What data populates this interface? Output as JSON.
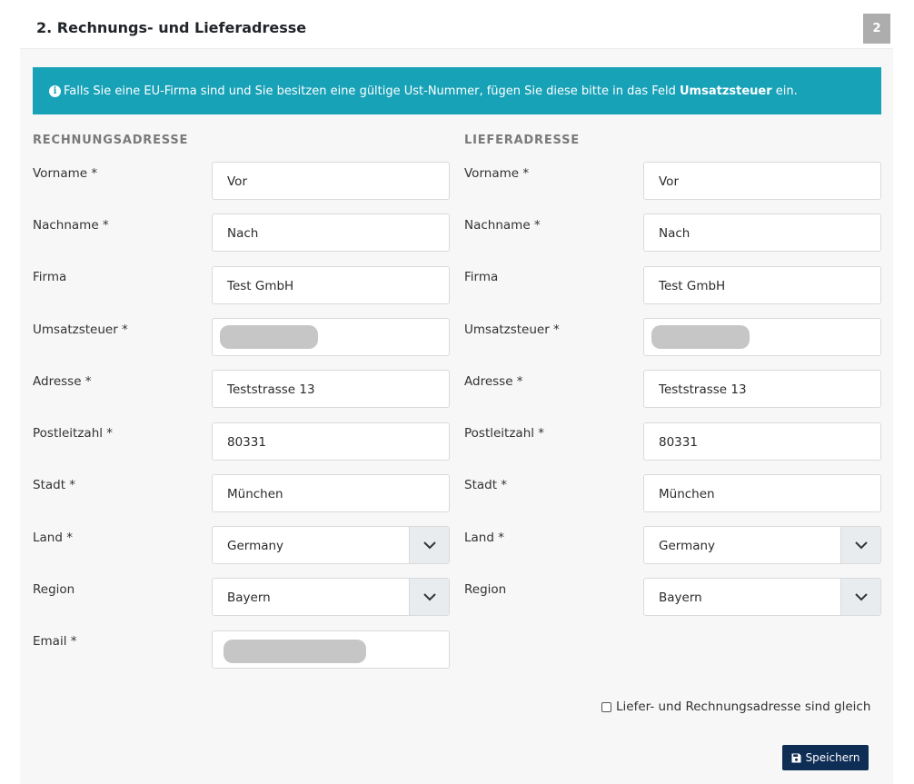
{
  "panel": {
    "title": "2. Rechnungs- und Lieferadresse",
    "step_number": "2"
  },
  "alert": {
    "text_before": "Falls Sie eine EU-Firma sind und Sie besitzen eine gültige Ust-Nummer, fügen Sie diese bitte in das Feld ",
    "text_bold": "Umsatzsteuer",
    "text_after": " ein."
  },
  "billing": {
    "heading": "RECHNUNGSADRESSE",
    "fields": {
      "vorname": {
        "label": "Vorname *",
        "value": "Vor"
      },
      "nachname": {
        "label": "Nachname *",
        "value": "Nach"
      },
      "firma": {
        "label": "Firma",
        "value": "Test GmbH"
      },
      "umsatzsteuer": {
        "label": "Umsatzsteuer *",
        "value": ""
      },
      "adresse": {
        "label": "Adresse *",
        "value": "Teststrasse 13"
      },
      "postleitzahl": {
        "label": "Postleitzahl *",
        "value": "80331"
      },
      "stadt": {
        "label": "Stadt *",
        "value": "München"
      },
      "land": {
        "label": "Land *",
        "value": "Germany"
      },
      "region": {
        "label": "Region",
        "value": "Bayern"
      },
      "email": {
        "label": "Email *",
        "value": ""
      }
    }
  },
  "shipping": {
    "heading": "LIEFERADRESSE",
    "fields": {
      "vorname": {
        "label": "Vorname *",
        "value": "Vor"
      },
      "nachname": {
        "label": "Nachname *",
        "value": "Nach"
      },
      "firma": {
        "label": "Firma",
        "value": "Test GmbH"
      },
      "umsatzsteuer": {
        "label": "Umsatzsteuer *",
        "value": ""
      },
      "adresse": {
        "label": "Adresse *",
        "value": "Teststrasse 13"
      },
      "postleitzahl": {
        "label": "Postleitzahl *",
        "value": "80331"
      },
      "stadt": {
        "label": "Stadt *",
        "value": "München"
      },
      "land": {
        "label": "Land *",
        "value": "Germany"
      },
      "region": {
        "label": "Region",
        "value": "Bayern"
      }
    }
  },
  "same_address": {
    "label": "Liefer- und Rechnungsadresse sind gleich",
    "checked": false
  },
  "save_button": {
    "label": "Speichern",
    "icon": "floppy-disk-icon"
  },
  "colors": {
    "alert_bg": "#17a2b8",
    "button_bg": "#0f2e55",
    "badge_bg": "#adadad"
  }
}
